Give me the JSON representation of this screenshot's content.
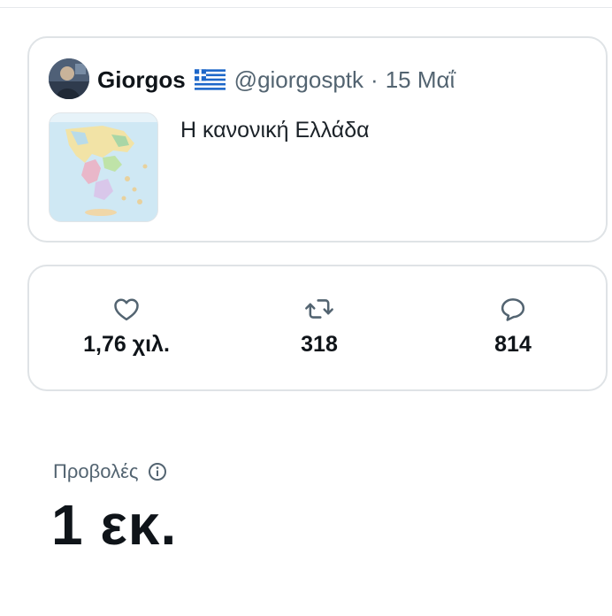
{
  "tweet": {
    "display_name": "Giorgos",
    "flag_icon": "greek-flag-icon",
    "handle": "@giorgosptk",
    "separator": "·",
    "date": "15 Μαΐ",
    "text": "Η κανονική Ελλάδα",
    "media_icon": "greece-map-thumbnail"
  },
  "stats": {
    "likes": {
      "icon": "heart-icon",
      "value": "1,76 χιλ."
    },
    "reposts": {
      "icon": "repost-icon",
      "value": "318"
    },
    "replies": {
      "icon": "reply-bubble-icon",
      "value": "814"
    }
  },
  "views": {
    "label": "Προβολές",
    "info_icon": "info-icon",
    "value": "1 εκ."
  },
  "colors": {
    "text_primary": "#0f1419",
    "text_secondary": "#536471",
    "border": "#dfe3e6"
  }
}
